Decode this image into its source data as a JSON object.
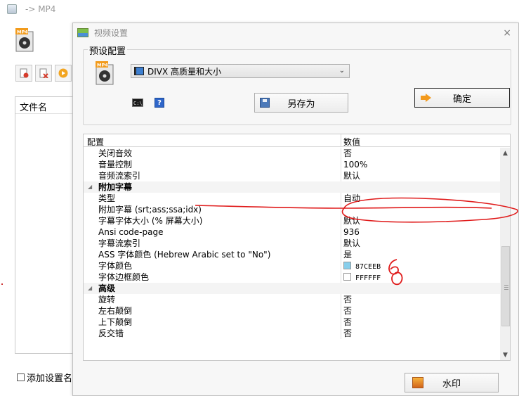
{
  "background_window": {
    "title": "-> MP4",
    "file_list_header": "文件名",
    "add_setting_name_checkbox": "添加设置名称"
  },
  "dialog": {
    "title": "视频设置",
    "close": "×",
    "preset_group_label": "预设配置",
    "preset_selected": "DIVX 高质量和大小",
    "save_as_button": "另存为",
    "ok_button": "确定",
    "watermark_button": "水印",
    "cmd_icon_text": "C:\\_",
    "help_icon_text": "?"
  },
  "grid": {
    "header_config": "配置",
    "header_value": "数值",
    "rows": [
      {
        "name": "关闭音效",
        "value": "否"
      },
      {
        "name": "音量控制",
        "value": "100%"
      },
      {
        "name": "音频流索引",
        "value": "默认"
      },
      {
        "category": "附加字幕"
      },
      {
        "name": "类型",
        "value": "自动"
      },
      {
        "name": "附加字幕 (srt;ass;ssa;idx)",
        "value": ""
      },
      {
        "name": "字幕字体大小 (% 屏幕大小)",
        "value": "默认"
      },
      {
        "name": "Ansi code-page",
        "value": "936"
      },
      {
        "name": "字幕流索引",
        "value": "默认"
      },
      {
        "name": "ASS 字体颜色 (Hebrew Arabic set to \"No\")",
        "value": "是"
      },
      {
        "name": "字体颜色",
        "value": "87CEEB",
        "swatch": "#87CEEB"
      },
      {
        "name": "字体边框颜色",
        "value": "FFFFFF",
        "swatch": "#FFFFFF"
      },
      {
        "category": "高级"
      },
      {
        "name": "旋转",
        "value": "否"
      },
      {
        "name": "左右颠倒",
        "value": "否"
      },
      {
        "name": "上下颠倒",
        "value": "否"
      },
      {
        "name": "反交错",
        "value": "否"
      }
    ]
  },
  "annotation": {
    "handwritten_text": "60",
    "color": "#e01b1b"
  }
}
